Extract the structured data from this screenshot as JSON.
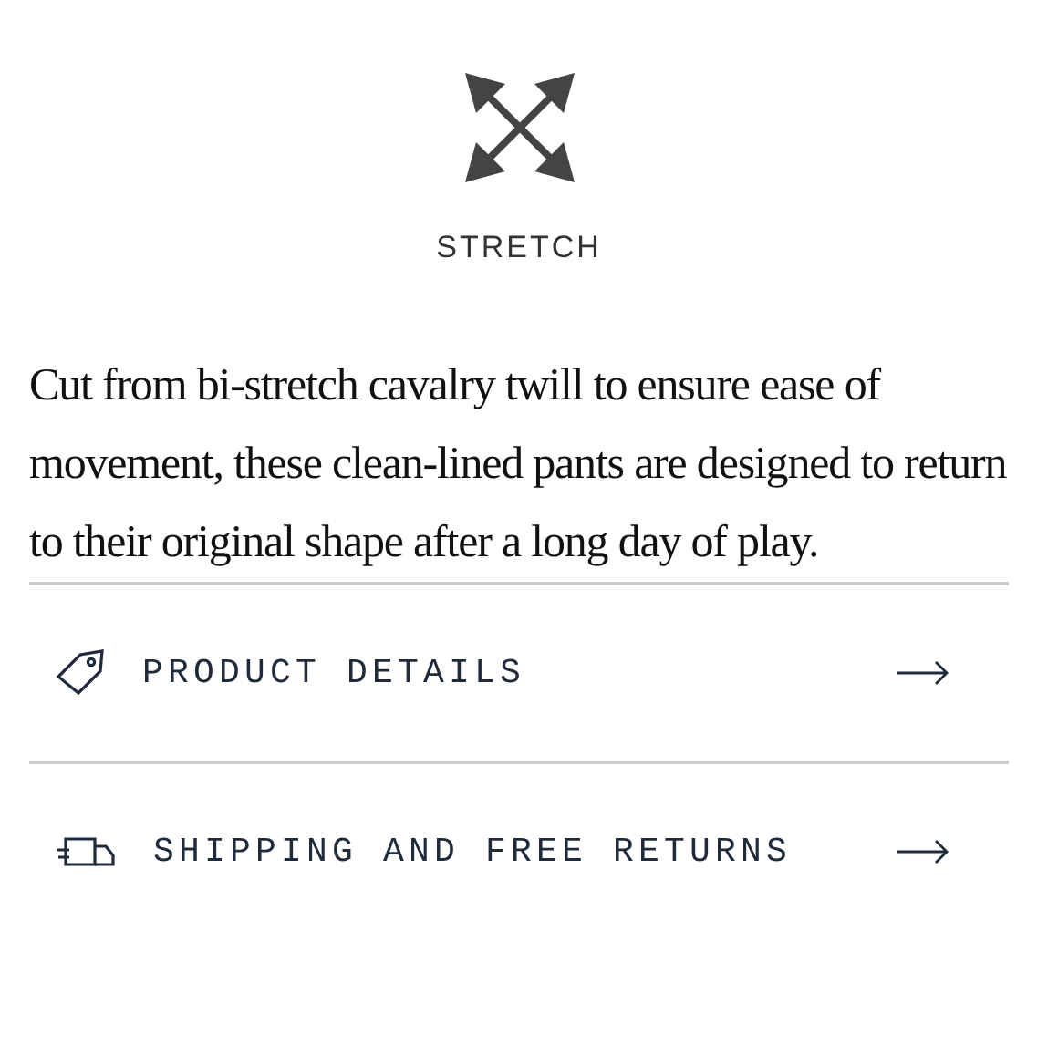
{
  "feature": {
    "label": "STRETCH"
  },
  "description": "Cut from bi-stretch cavalry twill to ensure ease of movement, these clean-lined pants are designed to return to their original shape after a long day of play.",
  "links": [
    {
      "kind": "tag",
      "label": "PRODUCT DETAILS"
    },
    {
      "kind": "truck",
      "label": "SHIPPING AND FREE RETURNS"
    }
  ]
}
